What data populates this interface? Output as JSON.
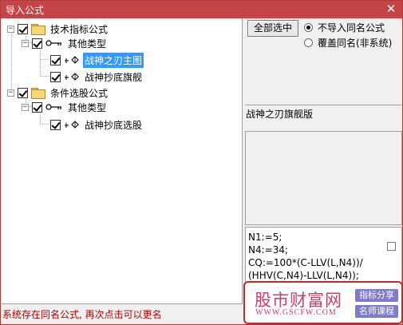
{
  "window": {
    "title": "导入公式",
    "close_glyph": "✕"
  },
  "tree": {
    "groups": [
      {
        "label": "技术指标公式",
        "checked": true,
        "subgroup": {
          "label": "其他类型",
          "checked": true,
          "items": [
            {
              "label": "战神之刃主图",
              "checked": true,
              "selected": true
            },
            {
              "label": "战神抄底旗舰",
              "checked": true,
              "selected": false
            }
          ]
        }
      },
      {
        "label": "条件选股公式",
        "checked": true,
        "subgroup": {
          "label": "其他类型",
          "checked": true,
          "items": [
            {
              "label": "战神抄底选股",
              "checked": true,
              "selected": false
            }
          ]
        }
      }
    ],
    "expander_glyph": "−",
    "icons": {
      "group": "folder-icon",
      "subgroup": "key-icon",
      "item": "formula-icon"
    }
  },
  "controls": {
    "select_all_label": "全部选中",
    "radio_options": [
      {
        "label": "不导入同名公式",
        "checked": true
      },
      {
        "label": "覆盖同名(非系统)",
        "checked": false
      }
    ]
  },
  "detail": {
    "formula_name": "战神之刃旗舰版",
    "code_lines": [
      "N1:=5;",
      "N4:=34;",
      "CQ:=100*(C-LLV(L,N4))/",
      "(HHV(C,N4)-LLV(L,N4));"
    ]
  },
  "status_text": "系统存在同名公式, 再次点击可以更名",
  "watermark": {
    "main": "股市财富网",
    "url": "WWW.GSCFW.COM",
    "tag1": "指标分享",
    "tag2": "名师课程"
  },
  "colors": {
    "titlebar": "#c54546",
    "selection": "#3399ff",
    "status": "#b00000",
    "watermark": "#d23a6a"
  }
}
